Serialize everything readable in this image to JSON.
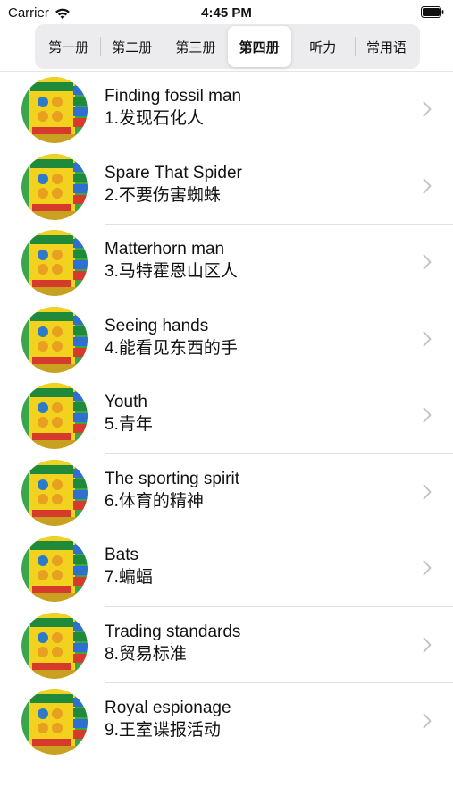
{
  "status_bar": {
    "carrier": "Carrier",
    "time": "4:45 PM"
  },
  "segments": [
    {
      "label": "第一册",
      "selected": false
    },
    {
      "label": "第二册",
      "selected": false
    },
    {
      "label": "第三册",
      "selected": false
    },
    {
      "label": "第四册",
      "selected": true
    },
    {
      "label": "听力",
      "selected": false
    },
    {
      "label": "常用语",
      "selected": false
    }
  ],
  "lessons": [
    {
      "title": "Finding fossil man",
      "subtitle": "1.发现石化人"
    },
    {
      "title": "Spare That Spider",
      "subtitle": "2.不要伤害蜘蛛"
    },
    {
      "title": "Matterhorn man",
      "subtitle": "3.马特霍恩山区人"
    },
    {
      "title": "Seeing hands",
      "subtitle": "4.能看见东西的手"
    },
    {
      "title": "Youth",
      "subtitle": "5.青年"
    },
    {
      "title": "The sporting spirit",
      "subtitle": "6.体育的精神"
    },
    {
      "title": "Bats",
      "subtitle": "7.蝙蝠"
    },
    {
      "title": "Trading standards",
      "subtitle": "8.贸易标准"
    },
    {
      "title": "Royal espionage",
      "subtitle": "9.王室谍报活动"
    }
  ],
  "icons": {
    "wifi": "wifi-icon",
    "battery": "battery-icon",
    "thumbnail": "book-cover-thumbnail",
    "disclosure": "chevron-right-icon"
  },
  "colors": {
    "segment_bg": "#ececee",
    "separator": "#e1e1e4",
    "chevron": "#c4c4c7",
    "cover_yellow": "#f2d21e",
    "cover_green": "#3aa54a"
  }
}
